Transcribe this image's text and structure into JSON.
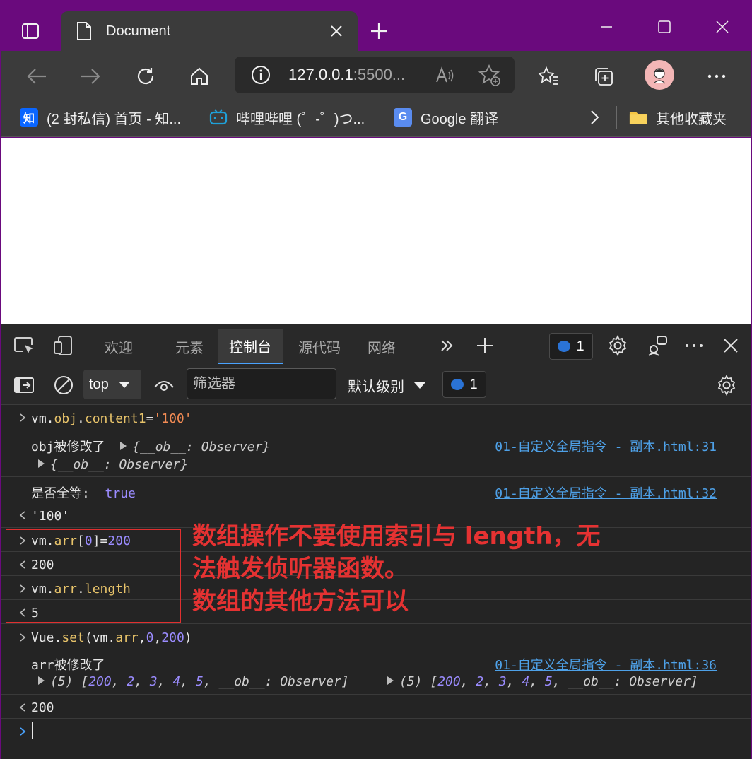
{
  "browser": {
    "tab_title": "Document",
    "url_host": "127.0.0.1",
    "url_rest": ":5500...",
    "favorites": [
      {
        "label": "(2 封私信) 首页 - 知...",
        "icon": "zhihu-icon",
        "glyph": "知",
        "color": "#0a66ff"
      },
      {
        "label": "哔哩哔哩 (゜-゜)つ...",
        "icon": "bilibili-icon",
        "glyph": "",
        "color": "#1fa0d8"
      },
      {
        "label": "Google 翻译",
        "icon": "google-translate-icon",
        "glyph": "G",
        "color": "#5a8cf0"
      }
    ],
    "other_favorites": "其他收藏夹"
  },
  "devtools": {
    "tabs": [
      "欢迎",
      "元素",
      "控制台",
      "源代码",
      "网络"
    ],
    "active_tab": "控制台",
    "message_count": "1",
    "context": "top",
    "filter_placeholder": "筛选器",
    "level": "默认级别",
    "filter_message_count": "1"
  },
  "console": {
    "input1": {
      "code_prefix": "vm.",
      "prop1": "obj",
      "dot": ".",
      "prop2": "content1",
      "eq": "=",
      "str": "'100'"
    },
    "log1": {
      "text": "obj被修改了",
      "obj_preview": "{__ob__: Observer}",
      "expanded": "{__ob__: Observer}",
      "source": "01-自定义全局指令 - 副本.html:31"
    },
    "log2": {
      "label": "是否全等:",
      "value": "true",
      "source": "01-自定义全局指令 - 副本.html:32"
    },
    "result1": "'100'",
    "input2": {
      "a": "vm.",
      "prop": "arr",
      "b": "[",
      "idx": "0",
      "c": "]=",
      "num": "200"
    },
    "result2": "200",
    "input3": {
      "a": "vm.",
      "prop1": "arr",
      "dot": ".",
      "prop2": "length"
    },
    "result3": "5",
    "input4": {
      "a": "Vue.",
      "fn": "set",
      "b": "(vm.",
      "prop": "arr",
      "c": ",",
      "n1": "0",
      "d": ",",
      "n2": "200",
      "e": ")"
    },
    "log3": {
      "text": "arr被修改了",
      "source": "01-自定义全局指令 - 副本.html:36",
      "array_preview": "(5) [200, 2, 3, 4, 5, __ob__: Observer]"
    },
    "result4": "200"
  },
  "annotation": {
    "line1": "数组操作不要使用索引与 length，无",
    "line2": "法触发侦听器函数。",
    "line3": "数组的其他方法可以",
    "color": "#e53232"
  }
}
